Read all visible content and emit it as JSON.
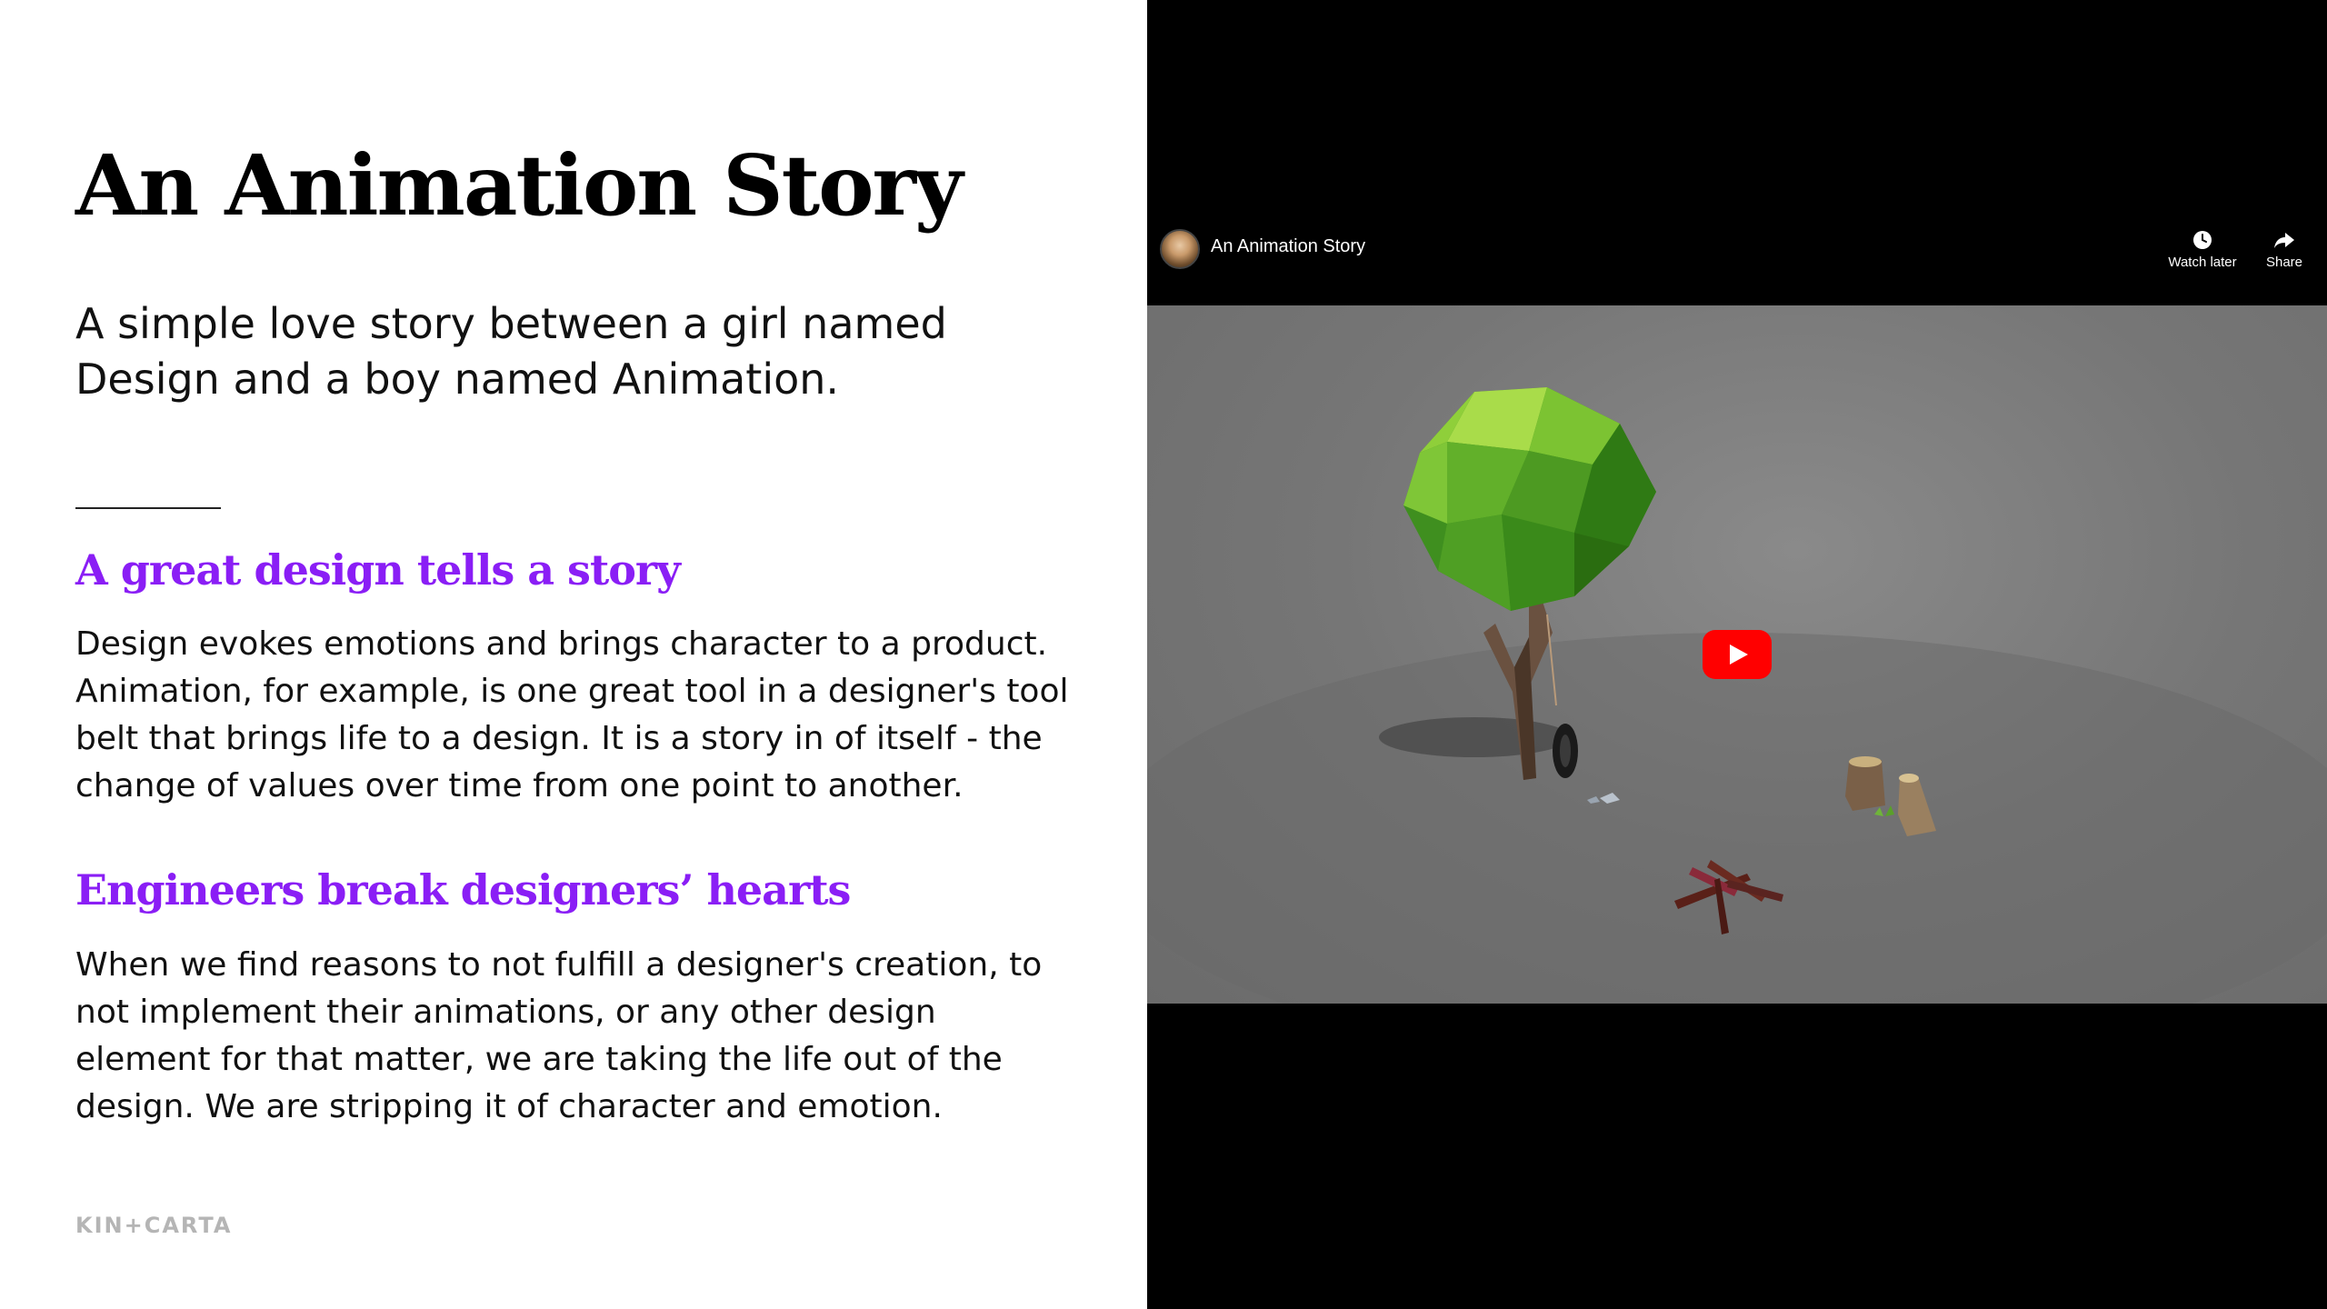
{
  "slide": {
    "title": "An Animation Story",
    "subtitle_lines": [
      "A simple love story between a girl named",
      "Design and a boy named Animation."
    ],
    "section1": {
      "heading": "A great design tells a story",
      "lines": [
        "Design evokes emotions and brings character to a product.",
        "Animation, for example, is one great tool in a designer's tool",
        "belt that brings life to a design. It is a story in of itself - the",
        "change of values over time from one point to another."
      ]
    },
    "section2": {
      "heading": "Engineers break designers’ hearts",
      "lines": [
        "When we find reasons to not fulfill a designer's creation, to",
        "not implement their animations, or any other design",
        "element for that matter, we are taking the life out of the",
        "design. We are stripping it of character and emotion."
      ]
    },
    "logo_text": "KIN+CARTA"
  },
  "video": {
    "title": "An Animation Story",
    "watch_later_label": "Watch later",
    "share_label": "Share",
    "play_button_color": "#ff0000",
    "icons": {
      "watch_later": "clock-icon",
      "share": "share-arrow-icon",
      "play": "play-icon"
    }
  },
  "colors": {
    "heading_accent": "#8a1ef5",
    "video_background": "#000000"
  }
}
